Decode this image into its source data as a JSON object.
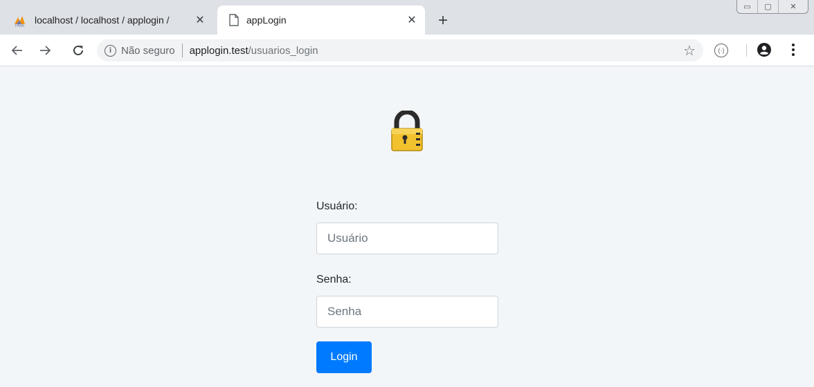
{
  "browser": {
    "tabs": [
      {
        "title": "localhost / localhost / applogin / ",
        "icon": "phpmyadmin-icon",
        "active": false
      },
      {
        "title": "appLogin",
        "icon": "document-icon",
        "active": true
      }
    ],
    "new_tab_label": "+",
    "close_glyph": "✕",
    "window_controls": [
      "▭",
      "▢",
      "✕"
    ],
    "omnibox": {
      "security_label": "Não seguro",
      "url_host": "applogin.test",
      "url_path": "/usuarios_login"
    }
  },
  "page": {
    "lock_icon": "padlock-icon",
    "username_label": "Usuário:",
    "username_placeholder": "Usuário",
    "password_label": "Senha:",
    "password_placeholder": "Senha",
    "login_button": "Login",
    "colors": {
      "background": "#f3f6f9",
      "primary_button": "#007bff",
      "lock_gold": "#f2c12e"
    }
  }
}
